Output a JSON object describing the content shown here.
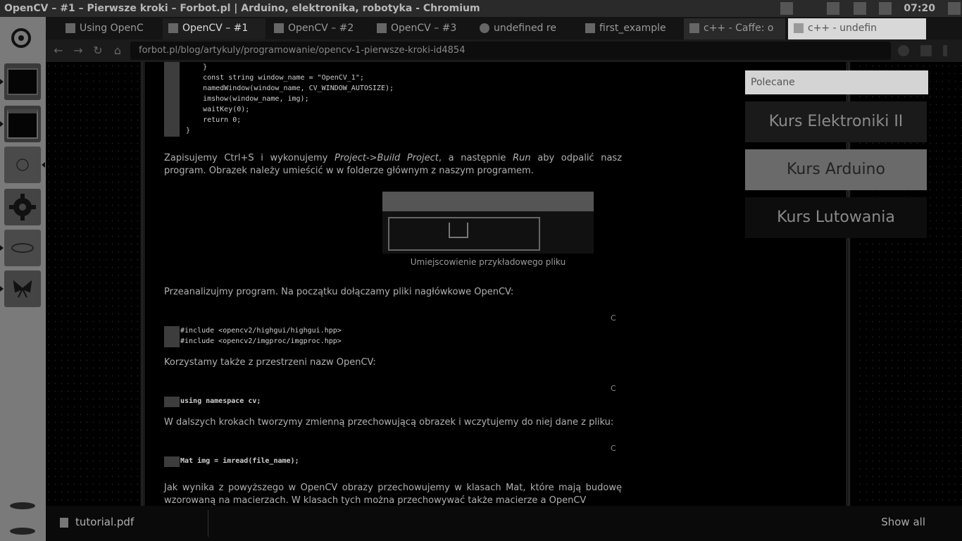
{
  "system": {
    "window_title": "OpenCV – #1 – Pierwsze kroki – Forbot.pl | Arduino, elektronika, robotyka - Chromium",
    "clock": "07:20"
  },
  "tabs": [
    {
      "label": "Using OpenC",
      "active": false
    },
    {
      "label": "OpenCV – #1",
      "active": true
    },
    {
      "label": "OpenCV – #2",
      "active": false
    },
    {
      "label": "OpenCV – #3",
      "active": false
    },
    {
      "label": "undefined re",
      "active": false
    },
    {
      "label": "first_example",
      "active": false
    },
    {
      "label": "c++ - Caffe: o",
      "active": false
    },
    {
      "label": "c++ - undefin",
      "active": false
    }
  ],
  "address": {
    "url": "forbot.pl/blog/artykuly/programowanie/opencv-1-pierwsze-kroki-id4854"
  },
  "code_block_1": {
    "lines": [
      "    }",
      "    const string window_name = \"OpenCV_1\";",
      "    namedWindow(window_name, CV_WINDOW_AUTOSIZE);",
      "    imshow(window_name, img);",
      "    waitKey(0);",
      "    return 0;",
      "}"
    ]
  },
  "paragraph_1": {
    "a": "Zapisujemy Ctrl+S i wykonujemy ",
    "b": "Project->Build Project",
    "c": ", a następnie ",
    "d": "Run",
    "e": " aby odpalić nasz program. Obrazek należy umieścić w w folderze głównym z naszym programem."
  },
  "figure": {
    "caption": "Umiejscowienie przykładowego pliku"
  },
  "paragraph_2": "Przeanalizujmy program. Na początku dołączamy pliki nagłówkowe OpenCV:",
  "code_lang_label": "C",
  "code_block_2": {
    "lines": [
      "#include <opencv2/highgui/highgui.hpp>",
      "#include <opencv2/imgproc/imgproc.hpp>"
    ]
  },
  "paragraph_3": "Korzystamy także z przestrzeni nazw OpenCV:",
  "code_block_3": {
    "lines": [
      "using namespace cv;"
    ]
  },
  "paragraph_4": "W dalszych krokach tworzymy zmienną przechowującą obrazek i wczytujemy do niej dane z pliku:",
  "code_block_4": {
    "lines": [
      "Mat img = imread(file_name);"
    ]
  },
  "paragraph_5": "Jak wynika z powyższego w OpenCV obrazy przechowujemy w klasach Mat, które mają budowę wzorowaną na macierzach. W klasach tych można przechowywać także macierze a OpenCV",
  "sidebar": {
    "heading": "Polecane",
    "links": [
      "Kurs Elektroniki II",
      "Kurs Arduino",
      "Kurs Lutowania"
    ]
  },
  "download_bar": {
    "file": "tutorial.pdf",
    "show_all": "Show all"
  }
}
